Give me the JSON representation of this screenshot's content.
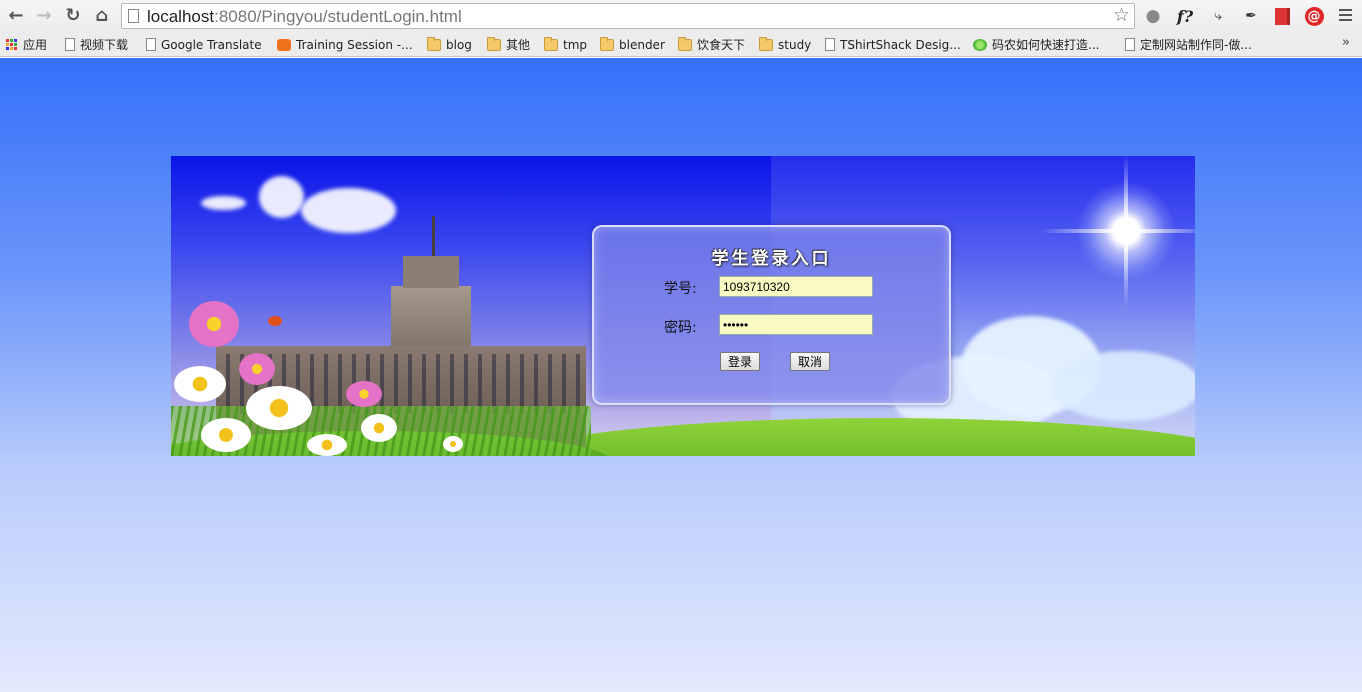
{
  "browser": {
    "url_host": "localhost",
    "url_rest": ":8080/Pingyou/studentLogin.html"
  },
  "bookmarks": [
    {
      "label": "应用",
      "icon": "apps-grid-icon"
    },
    {
      "label": "视频下载",
      "icon": "page-icon"
    },
    {
      "label": "Google Translate",
      "icon": "page-icon"
    },
    {
      "label": "Training Session -...",
      "icon": "training-icon"
    },
    {
      "label": "blog",
      "icon": "folder-icon"
    },
    {
      "label": "其他",
      "icon": "folder-icon"
    },
    {
      "label": "tmp",
      "icon": "folder-icon"
    },
    {
      "label": "blender",
      "icon": "folder-icon"
    },
    {
      "label": "饮食天下",
      "icon": "folder-icon"
    },
    {
      "label": "study",
      "icon": "folder-icon"
    },
    {
      "label": "TShirtShack Desig...",
      "icon": "page-icon"
    },
    {
      "label": "码农如何快速打造...",
      "icon": "green-flower-icon"
    },
    {
      "label": "定制网站制作同-做...",
      "icon": "page-icon"
    }
  ],
  "bookmarks_more": "»",
  "login": {
    "title": "学生登录入口",
    "student_id_label": "学号:",
    "student_id_value": "1093710320",
    "password_label": "密码:",
    "password_value": "••••••",
    "login_button": "登录",
    "cancel_button": "取消"
  },
  "colors": {
    "page_top": "#3470fb",
    "page_bottom": "#e3eafd",
    "input_bg": "#fafac3"
  }
}
